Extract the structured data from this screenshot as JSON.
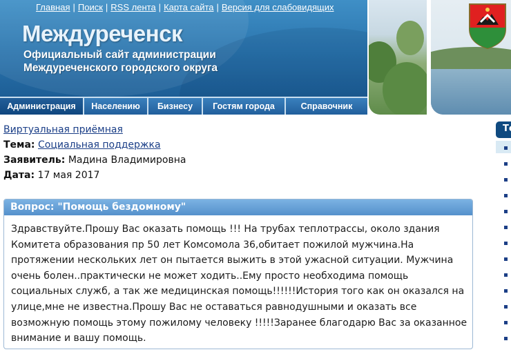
{
  "header": {
    "top_links": [
      "Главная",
      "Поиск",
      "RSS лента",
      "Карта сайта",
      "Версия для слабовидящих"
    ],
    "site_title": "Междуреченск",
    "site_subtitle_line1": "Официальный сайт администрации",
    "site_subtitle_line2": "Междуреченского городского округа"
  },
  "nav": [
    {
      "label": "Администрация",
      "active": true
    },
    {
      "label": "Населению",
      "active": false
    },
    {
      "label": "Бизнесу",
      "active": false
    },
    {
      "label": "Гостям города",
      "active": false
    },
    {
      "label": "Справочник",
      "active": false
    }
  ],
  "breadcrumb": "Виртуальная приёмная",
  "topic": {
    "label": "Тема:",
    "value": "Социальная поддержка"
  },
  "applicant": {
    "label": "Заявитель:",
    "value": "Мадина Владимировна"
  },
  "date": {
    "label": "Дата:",
    "value": "17 мая 2017"
  },
  "question": {
    "title": "Вопрос: \"Помощь бездомному\"",
    "text": "Здравствуйте.Прошу Вас оказать помощь !!! На трубах теплотрассы, около здания Комитета образования пр 50 лет Комсомола 36,обитает пожилой мужчина.На протяжении нескольких лет он пытается выжить в этой ужасной ситуации. Мужчина очень болен..практически не может ходить..Ему просто необходима помощь социальных служб, а так же медицинская помощь!!!!!!История того как он оказался на улице,мне не известна.Прошу Вас не оставаться равнодушными и оказать все возможную помощь этому пожилому человеку !!!!!Заранее благодарю Вас за оказанное внимание и вашу помощь."
  },
  "sidebar": {
    "header_fragment": "Те"
  },
  "colors": {
    "nav_dark": "#0e4c86",
    "link": "#1a3e87",
    "question_header": "#5a95cf"
  }
}
